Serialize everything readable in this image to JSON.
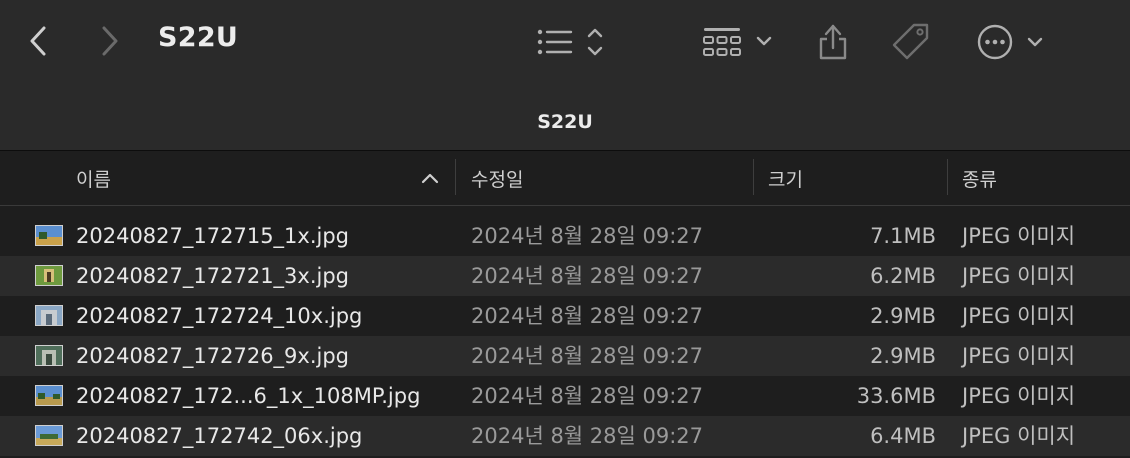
{
  "toolbar": {
    "title": "S22U",
    "icons": [
      "back-icon",
      "forward-icon",
      "list-view-icon",
      "group-icon",
      "share-icon",
      "tag-icon",
      "more-icon"
    ]
  },
  "pathbar": {
    "title": "S22U"
  },
  "columns": {
    "name": "이름",
    "date": "수정일",
    "size": "크기",
    "kind": "종류"
  },
  "files": [
    {
      "name": "20240827_172715_1x.jpg",
      "date": "2024년 8월 28일 09:27",
      "size": "7.1MB",
      "kind": "JPEG 이미지"
    },
    {
      "name": "20240827_172721_3x.jpg",
      "date": "2024년 8월 28일 09:27",
      "size": "6.2MB",
      "kind": "JPEG 이미지"
    },
    {
      "name": "20240827_172724_10x.jpg",
      "date": "2024년 8월 28일 09:27",
      "size": "2.9MB",
      "kind": "JPEG 이미지"
    },
    {
      "name": "20240827_172726_9x.jpg",
      "date": "2024년 8월 28일 09:27",
      "size": "2.9MB",
      "kind": "JPEG 이미지"
    },
    {
      "name": "20240827_172...6_1x_108MP.jpg",
      "date": "2024년 8월 28일 09:27",
      "size": "33.6MB",
      "kind": "JPEG 이미지"
    },
    {
      "name": "20240827_172742_06x.jpg",
      "date": "2024년 8월 28일 09:27",
      "size": "6.4MB",
      "kind": "JPEG 이미지"
    }
  ],
  "colors": {
    "background": "#1e1e1e",
    "toolbar": "#2a2a2a",
    "row_alt": "#2b2b2b",
    "text": "#e8e8e8",
    "text_secondary": "#9a9a9a",
    "icon": "#a8a8a8"
  }
}
